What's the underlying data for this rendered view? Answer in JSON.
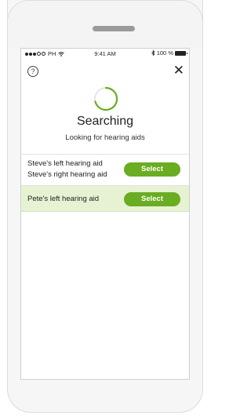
{
  "status_bar": {
    "carrier": "PH",
    "time": "9:41 AM",
    "battery": "100 %"
  },
  "header": {
    "help_icon": "question-circle-icon",
    "close_icon": "close-icon",
    "help_glyph": "?",
    "close_glyph": "✕"
  },
  "search": {
    "title": "Searching",
    "subtitle": "Looking for hearing aids"
  },
  "devices": [
    {
      "names": [
        "Steve's left hearing aid",
        "Steve's right hearing aid"
      ],
      "button": "Select",
      "highlighted": false
    },
    {
      "names": [
        "Pete's left hearing aid"
      ],
      "button": "Select",
      "highlighted": true
    }
  ],
  "colors": {
    "accent": "#6aac22",
    "highlight_row": "#e6f2d2"
  }
}
